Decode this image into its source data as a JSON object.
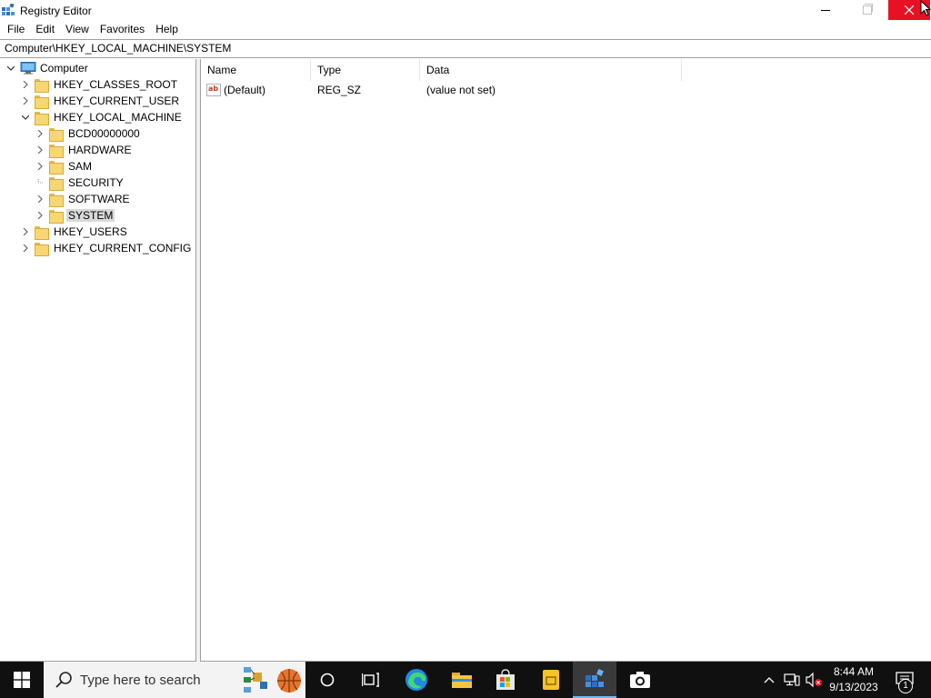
{
  "window": {
    "title": "Registry Editor"
  },
  "menu": [
    "File",
    "Edit",
    "View",
    "Favorites",
    "Help"
  ],
  "address": "Computer\\HKEY_LOCAL_MACHINE\\SYSTEM",
  "tree": {
    "root": "Computer",
    "hives": [
      "HKEY_CLASSES_ROOT",
      "HKEY_CURRENT_USER",
      "HKEY_LOCAL_MACHINE"
    ],
    "hklm_children": [
      "BCD00000000",
      "HARDWARE",
      "SAM",
      "SECURITY",
      "SOFTWARE",
      "SYSTEM"
    ],
    "hives_after": [
      "HKEY_USERS",
      "HKEY_CURRENT_CONFIG"
    ],
    "selected": "SYSTEM"
  },
  "list": {
    "columns": [
      "Name",
      "Type",
      "Data"
    ],
    "rows": [
      {
        "name": "(Default)",
        "type": "REG_SZ",
        "data": "(value not set)",
        "icon": "ab"
      }
    ]
  },
  "taskbar": {
    "search_placeholder": "Type here to search",
    "time": "8:44 AM",
    "date": "9/13/2023",
    "notification_count": "1"
  },
  "colors": {
    "close_button": "#e81123",
    "taskbar": "#101010",
    "selection": "#d9d9d9",
    "folder": "#f7d774"
  }
}
